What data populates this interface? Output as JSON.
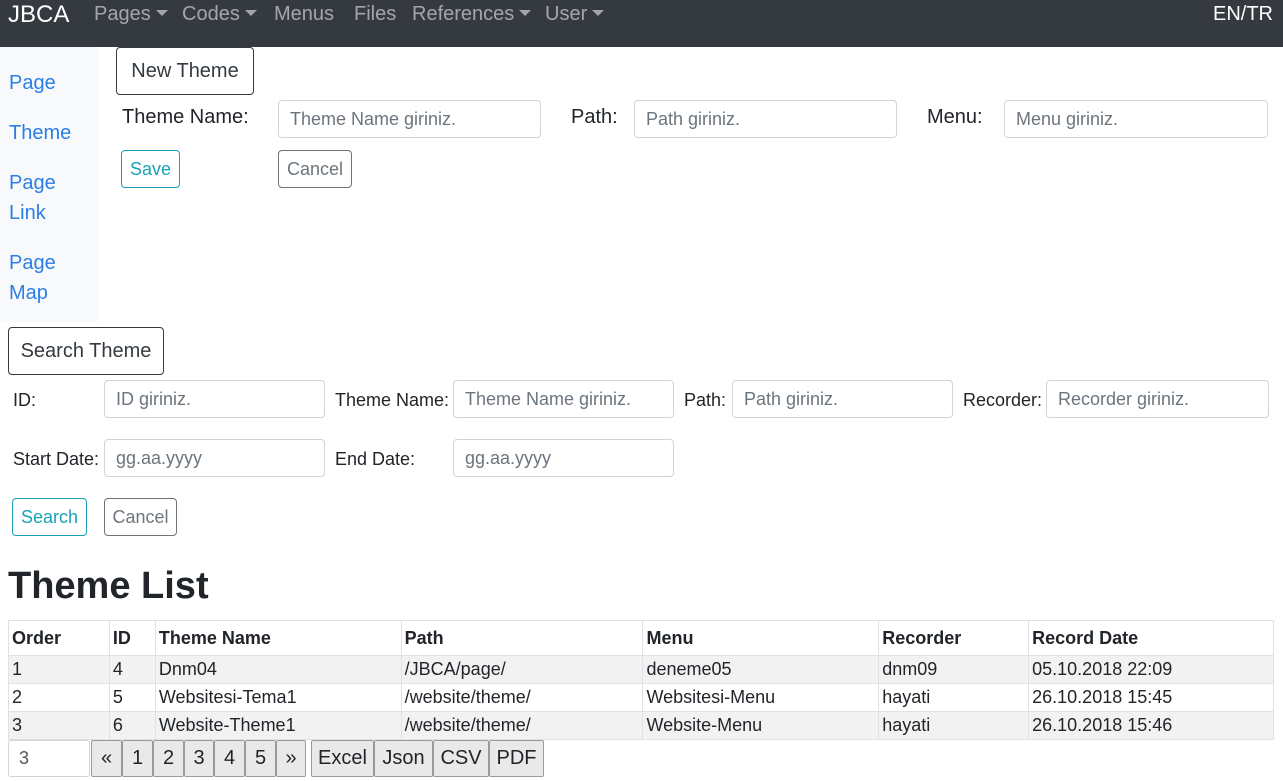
{
  "navbar": {
    "brand": "JBCA",
    "items": [
      {
        "label": "Pages",
        "dropdown": true
      },
      {
        "label": "Codes",
        "dropdown": true
      },
      {
        "label": "Menus",
        "dropdown": false
      },
      {
        "label": "Files",
        "dropdown": false
      },
      {
        "label": "References",
        "dropdown": true
      },
      {
        "label": "User",
        "dropdown": true
      }
    ],
    "lang": "EN/TR"
  },
  "sidebar": {
    "items": [
      {
        "label": "Page"
      },
      {
        "label": "Theme"
      },
      {
        "label": "Page\nLink"
      },
      {
        "label": "Page\nMap"
      }
    ]
  },
  "new_theme": {
    "title": "New Theme",
    "theme_name_label": "Theme Name:",
    "theme_name_placeholder": "Theme Name giriniz.",
    "path_label": "Path:",
    "path_placeholder": "Path giriniz.",
    "menu_label": "Menu:",
    "menu_placeholder": "Menu giriniz.",
    "save": "Save",
    "cancel": "Cancel"
  },
  "search_theme": {
    "title": "Search Theme",
    "id_label": "ID:",
    "id_placeholder": "ID giriniz.",
    "theme_name_label": "Theme Name:",
    "theme_name_placeholder": "Theme Name giriniz.",
    "path_label": "Path:",
    "path_placeholder": "Path giriniz.",
    "recorder_label": "Recorder:",
    "recorder_placeholder": "Recorder giriniz.",
    "start_date_label": "Start Date:",
    "start_date_placeholder": "gg.aa.yyyy",
    "end_date_label": "End Date:",
    "end_date_placeholder": "gg.aa.yyyy",
    "search": "Search",
    "cancel": "Cancel"
  },
  "theme_list": {
    "title": "Theme List",
    "columns": [
      "Order",
      "ID",
      "Theme Name",
      "Path",
      "Menu",
      "Recorder",
      "Record Date"
    ],
    "rows": [
      [
        "1",
        "4",
        "Dnm04",
        "/JBCA/page/",
        "deneme05",
        "dnm09",
        "05.10.2018 22:09"
      ],
      [
        "2",
        "5",
        "Websitesi-Tema1",
        "/website/theme/",
        "Websitesi-Menu",
        "hayati",
        "26.10.2018 15:45"
      ],
      [
        "3",
        "6",
        "Website-Theme1",
        "/website/theme/",
        "Website-Menu",
        "hayati",
        "26.10.2018 15:46"
      ]
    ]
  },
  "pager": {
    "page_size": "3",
    "prev": "«",
    "pages": [
      "1",
      "2",
      "3",
      "4",
      "5"
    ],
    "next": "»",
    "exports": [
      "Excel",
      "Json",
      "CSV",
      "PDF"
    ]
  },
  "colors": {
    "navbar_bg": "#343a40",
    "link": "#2a7ee6",
    "info": "#17a2b8"
  }
}
